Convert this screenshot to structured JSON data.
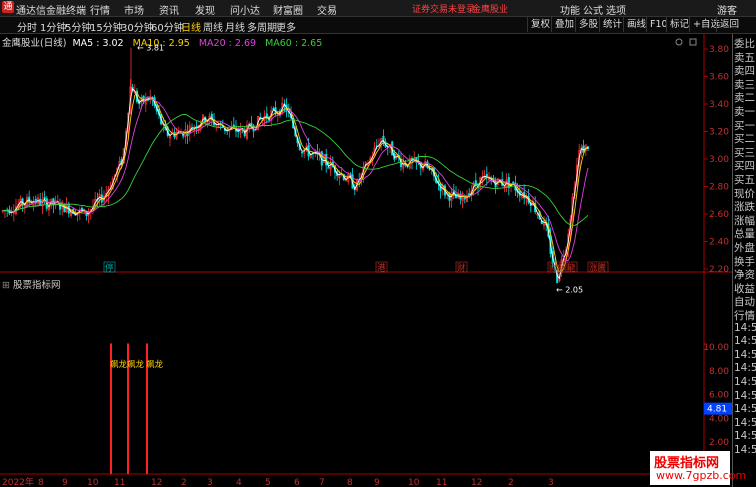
{
  "app": {
    "title": "通达信金融终端",
    "menus": [
      "行情",
      "市场",
      "资讯",
      "发现",
      "问小达",
      "财富圈",
      "交易"
    ],
    "warning": "证券交易未登录",
    "stock_short": "金鹰股业",
    "right_menus": [
      "功能",
      "公式",
      "选项"
    ],
    "user": "游客"
  },
  "toolbar": {
    "periods": [
      "分时",
      "1分钟",
      "5分钟",
      "15分钟",
      "30分钟",
      "60分钟",
      "日线",
      "周线",
      "月线",
      "多周期",
      "更多"
    ],
    "active_period": "日线",
    "right_tools": [
      "复权",
      "叠加",
      "多股",
      "统计",
      "画线",
      "F10",
      "标记",
      "+自选",
      "返回"
    ]
  },
  "chart": {
    "stock_name": "金鹰股业(日线)",
    "ma_labels": [
      {
        "name": "MA5",
        "value": "3.02",
        "color": "#ffffff"
      },
      {
        "name": "MA10",
        "value": "2.95",
        "color": "#ffd400"
      },
      {
        "name": "MA20",
        "value": "2.69",
        "color": "#e040e0"
      },
      {
        "name": "MA60",
        "value": "2.65",
        "color": "#39d039"
      }
    ],
    "y_ticks": [
      "3.80",
      "3.60",
      "3.40",
      "3.20",
      "3.00",
      "2.80",
      "2.60",
      "2.40",
      "2.20"
    ],
    "high_label": "3.81",
    "low_label": "2.05",
    "event_tags": [
      "停",
      "港",
      "财",
      "财解",
      "龍",
      "涨騰"
    ],
    "indicator_title": "股票指标网",
    "indicator_ticks": [
      "10.00",
      "8.00",
      "6.00",
      "4.00",
      "2.00"
    ],
    "indicator_value": "4.81",
    "indicator_labels": [
      "飙龙",
      "飙龙",
      "飙龙"
    ],
    "x_labels": [
      "2022年",
      "8",
      "9",
      "10",
      "11",
      "12",
      "2",
      "3",
      "4",
      "5",
      "6",
      "7",
      "8",
      "9",
      "10",
      "11",
      "12",
      "2",
      "3"
    ]
  },
  "side_panel": {
    "items": [
      "委比",
      "卖五",
      "卖四",
      "卖三",
      "卖二",
      "卖一",
      "买一",
      "买二",
      "买三",
      "买四",
      "买五",
      "现价",
      "涨跌",
      "涨幅",
      "总量",
      "外盘",
      "换手",
      "净资",
      "收益",
      "自动",
      "行情",
      "14:5",
      "14:5",
      "14:5",
      "14:5",
      "14:5",
      "14:5",
      "14:5",
      "14:5",
      "14:5",
      "14:5"
    ]
  },
  "watermark": {
    "line1": "股票指标网",
    "line2": "www.7gpzb.com"
  },
  "colors": {
    "up": "#ff3232",
    "down": "#00e0e0",
    "accent": "#ffd200",
    "ma5": "#ffffff",
    "ma10": "#ffd400",
    "ma20": "#e040e0",
    "ma60": "#39d039"
  }
}
